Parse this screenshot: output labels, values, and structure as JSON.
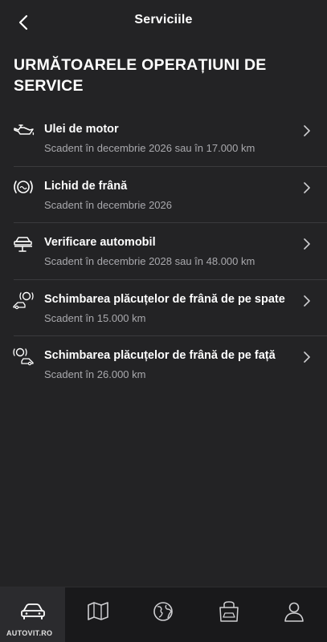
{
  "header": {
    "back_icon": "chevron-left-icon",
    "title": "Serviciile"
  },
  "section": {
    "title": "URMĂTOARELE OPERAȚIUNI DE SERVICE"
  },
  "items": [
    {
      "icon": "oil-can-icon",
      "label": "Ulei de motor",
      "due": "Scadent în decembrie 2026 sau în 17.000 km"
    },
    {
      "icon": "brake-fluid-icon",
      "label": "Lichid de frână",
      "due": "Scadent în decembrie 2026"
    },
    {
      "icon": "car-lift-icon",
      "label": "Verificare automobil",
      "due": "Scadent în decembrie 2028 sau în 48.000 km"
    },
    {
      "icon": "rear-brake-pads-icon",
      "label": "Schimbarea plăcuțelor de frână de pe spate",
      "due": "Scadent în 15.000 km"
    },
    {
      "icon": "front-brake-pads-icon",
      "label": "Schimbarea plăcuțelor de frână de pe față",
      "due": "Scadent în 26.000 km"
    }
  ],
  "tabbar": {
    "tabs": [
      {
        "icon": "car-icon",
        "active": true
      },
      {
        "icon": "map-icon",
        "active": false
      },
      {
        "icon": "globe-icon",
        "active": false
      },
      {
        "icon": "shop-car-icon",
        "active": false
      },
      {
        "icon": "profile-icon",
        "active": false
      }
    ]
  },
  "watermark": "AUTOVIT.RO",
  "colors": {
    "background": "#232325",
    "tabbar": "#19191b",
    "text": "#ffffff",
    "secondary_text": "#a9a9ad",
    "divider": "#3a3a3d"
  }
}
